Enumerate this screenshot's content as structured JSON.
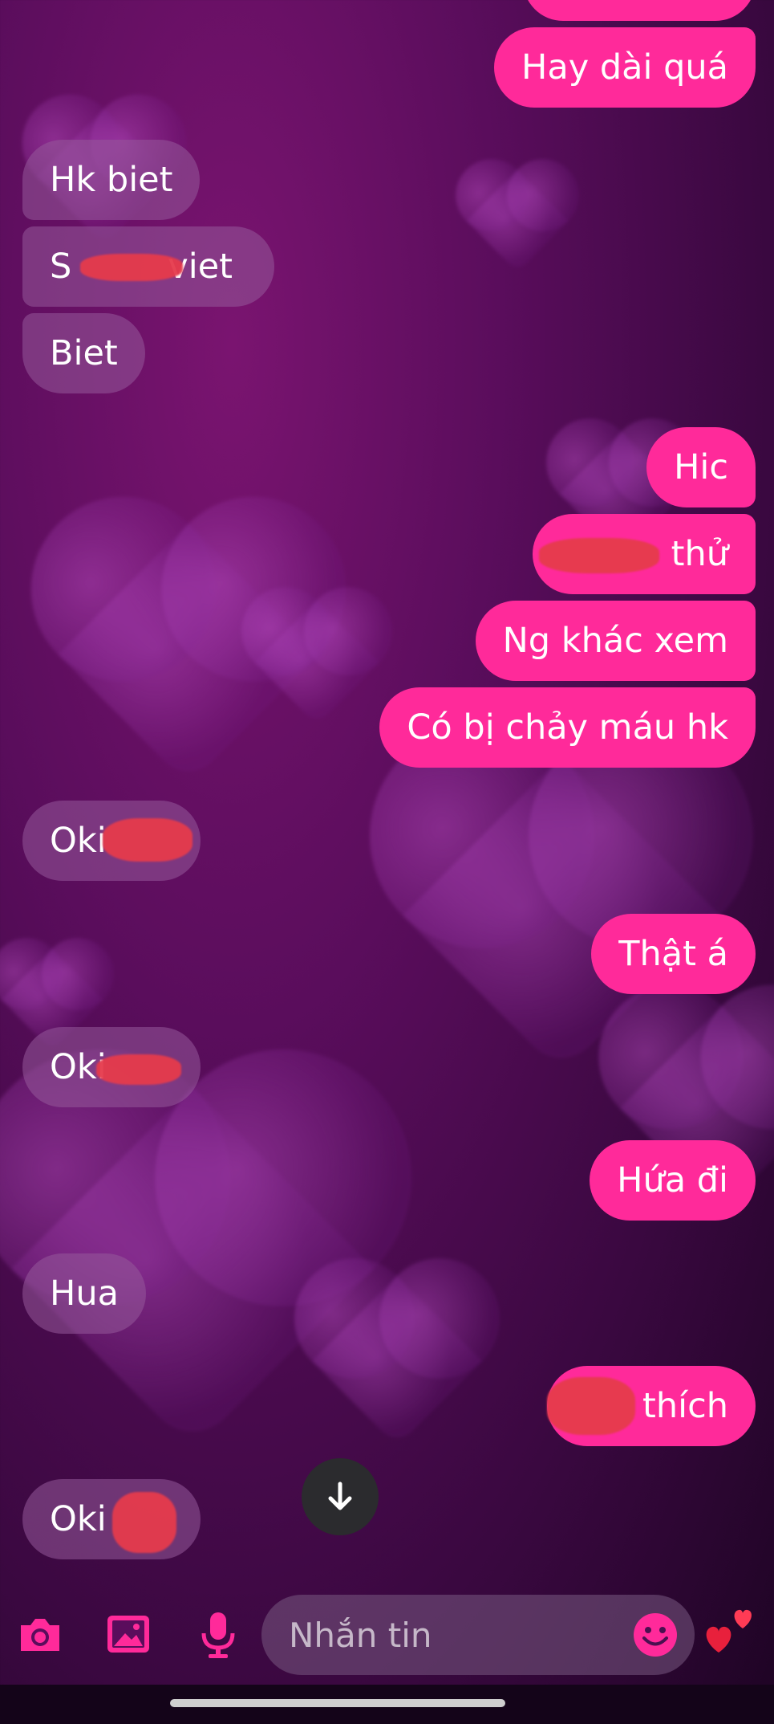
{
  "messages": {
    "m1": "Hay dài quá",
    "m2": "Hk biet",
    "m3_a": "S",
    "m3_b": "viet",
    "m4": "Biet",
    "m5": "Hic",
    "m6": "thử",
    "m7": "Ng khác xem",
    "m8": "Có bị chảy máu hk",
    "m9": "Oki",
    "m10": "Thật á",
    "m11": "Oki",
    "m12": "Hứa đi",
    "m13": "Hua",
    "m14": "thích",
    "m15": "Oki"
  },
  "composer": {
    "placeholder": "Nhắn tin"
  },
  "icons": {
    "camera": "camera-icon",
    "gallery": "image-icon",
    "mic": "microphone-icon",
    "emoji": "emoji-icon",
    "reaction": "hearts-icon",
    "scroll_down": "arrow-down-icon"
  },
  "colors": {
    "outgoing_bubble": "#ff2a9a",
    "incoming_bubble": "#8a4f8e",
    "accent": "#ff2a9a",
    "redaction": "#e63b4c"
  }
}
